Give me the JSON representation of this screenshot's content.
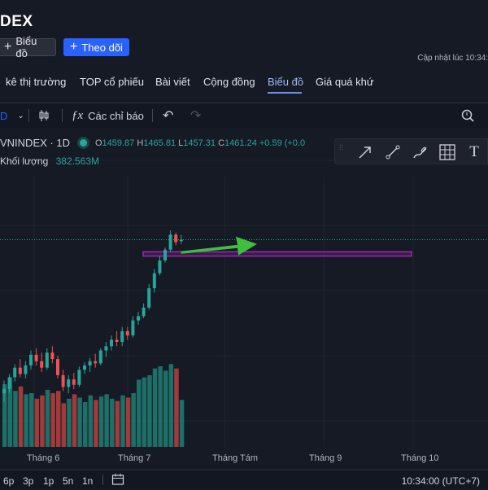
{
  "header": {
    "title": "DEX",
    "chart_button": "Biểu đồ",
    "follow_button": "Theo dõi",
    "updated": "Cập nhật lúc  10:34:"
  },
  "tabs": [
    {
      "label": "kê thị trường",
      "active": false
    },
    {
      "label": "TOP cổ phiếu",
      "active": false
    },
    {
      "label": "Bài viết",
      "active": false
    },
    {
      "label": "Cộng đồng",
      "active": false
    },
    {
      "label": "Biểu đồ",
      "active": true
    },
    {
      "label": "Giá quá khứ",
      "active": false
    }
  ],
  "toolbar": {
    "interval": "D",
    "indicators": "Các chỉ báo"
  },
  "legend": {
    "symbol": "VNINDEX · 1D",
    "o_label": "O",
    "o_value": "1459.87",
    "h_label": "H",
    "h_value": "1465.81",
    "l_label": "L",
    "l_value": "1457.31",
    "c_label": "C",
    "c_value": "1461.24",
    "change": "+0.59 (+0.0",
    "volume_label": "Khối lượng",
    "volume_value": "382.563M"
  },
  "drawing_tools": [
    {
      "name": "arrow-tool-icon"
    },
    {
      "name": "trend-line-icon"
    },
    {
      "name": "brush-icon"
    },
    {
      "name": "grid-icon"
    },
    {
      "name": "text-tool-icon"
    }
  ],
  "chart_data": {
    "type": "candlestick",
    "x_axis_labels": [
      "Tháng 6",
      "Tháng 7",
      "Tháng Tám",
      "Tháng 9",
      "Tháng 10"
    ],
    "colors": {
      "up": "#26a69a",
      "down": "#ef5350",
      "arrow": "#3fbf3f",
      "zone": "#9c27b0",
      "price_line": "#26a69a"
    },
    "last_close": 1461.24,
    "candles": [
      {
        "o": 1318,
        "h": 1330,
        "l": 1310,
        "c": 1322
      },
      {
        "o": 1322,
        "h": 1336,
        "l": 1318,
        "c": 1333
      },
      {
        "o": 1333,
        "h": 1345,
        "l": 1329,
        "c": 1342
      },
      {
        "o": 1342,
        "h": 1350,
        "l": 1333,
        "c": 1336
      },
      {
        "o": 1336,
        "h": 1348,
        "l": 1332,
        "c": 1344
      },
      {
        "o": 1344,
        "h": 1358,
        "l": 1340,
        "c": 1354
      },
      {
        "o": 1354,
        "h": 1360,
        "l": 1344,
        "c": 1348
      },
      {
        "o": 1348,
        "h": 1356,
        "l": 1338,
        "c": 1342
      },
      {
        "o": 1342,
        "h": 1360,
        "l": 1340,
        "c": 1356
      },
      {
        "o": 1356,
        "h": 1362,
        "l": 1346,
        "c": 1350
      },
      {
        "o": 1350,
        "h": 1353,
        "l": 1332,
        "c": 1335
      },
      {
        "o": 1335,
        "h": 1340,
        "l": 1320,
        "c": 1324
      },
      {
        "o": 1324,
        "h": 1335,
        "l": 1318,
        "c": 1331
      },
      {
        "o": 1331,
        "h": 1337,
        "l": 1322,
        "c": 1326
      },
      {
        "o": 1326,
        "h": 1343,
        "l": 1324,
        "c": 1340
      },
      {
        "o": 1340,
        "h": 1347,
        "l": 1336,
        "c": 1344
      },
      {
        "o": 1344,
        "h": 1351,
        "l": 1338,
        "c": 1348
      },
      {
        "o": 1348,
        "h": 1355,
        "l": 1342,
        "c": 1346
      },
      {
        "o": 1346,
        "h": 1360,
        "l": 1344,
        "c": 1358
      },
      {
        "o": 1358,
        "h": 1366,
        "l": 1352,
        "c": 1362
      },
      {
        "o": 1362,
        "h": 1372,
        "l": 1358,
        "c": 1368
      },
      {
        "o": 1368,
        "h": 1376,
        "l": 1362,
        "c": 1366
      },
      {
        "o": 1366,
        "h": 1380,
        "l": 1362,
        "c": 1376
      },
      {
        "o": 1376,
        "h": 1380,
        "l": 1368,
        "c": 1372
      },
      {
        "o": 1372,
        "h": 1390,
        "l": 1370,
        "c": 1386
      },
      {
        "o": 1386,
        "h": 1394,
        "l": 1382,
        "c": 1390
      },
      {
        "o": 1390,
        "h": 1402,
        "l": 1388,
        "c": 1398
      },
      {
        "o": 1398,
        "h": 1420,
        "l": 1396,
        "c": 1416
      },
      {
        "o": 1416,
        "h": 1434,
        "l": 1412,
        "c": 1430
      },
      {
        "o": 1430,
        "h": 1446,
        "l": 1428,
        "c": 1442
      },
      {
        "o": 1442,
        "h": 1454,
        "l": 1440,
        "c": 1452
      },
      {
        "o": 1452,
        "h": 1470,
        "l": 1450,
        "c": 1466
      },
      {
        "o": 1466,
        "h": 1468,
        "l": 1456,
        "c": 1459
      },
      {
        "o": 1459.87,
        "h": 1465.81,
        "l": 1457.31,
        "c": 1461.24
      }
    ],
    "volumes": [
      560,
      620,
      500,
      540,
      470,
      480,
      430,
      460,
      510,
      480,
      500,
      390,
      430,
      470,
      440,
      400,
      460,
      420,
      450,
      470,
      430,
      410,
      460,
      440,
      480,
      600,
      620,
      640,
      700,
      720,
      680,
      740,
      700,
      420
    ],
    "zone": {
      "from": 1446,
      "to": 1450
    }
  },
  "bottom": {
    "ranges": [
      "6p",
      "3p",
      "1p",
      "5n",
      "1n"
    ],
    "time": "10:34:00 (UTC+7)"
  }
}
